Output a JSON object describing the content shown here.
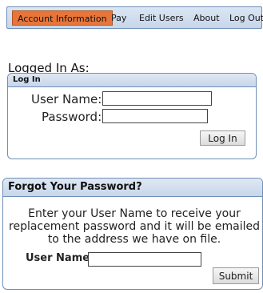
{
  "nav": {
    "items": [
      {
        "label": "Account Information",
        "active": true
      },
      {
        "label": "Pay",
        "active": false
      },
      {
        "label": "Edit Users",
        "active": false
      },
      {
        "label": "About",
        "active": false
      },
      {
        "label": "Log Out",
        "active": false
      }
    ]
  },
  "logged_in_as": "Logged In As:",
  "login": {
    "header": "Log In",
    "username_label": "User Name:",
    "username_value": "",
    "password_label": "Password:",
    "password_value": "",
    "button": "Log In"
  },
  "forgot": {
    "header": "Forgot Your Password?",
    "text": "Enter your User Name to receive your replacement password and it will be emailed to the address we have on file.",
    "username_label": "User Name:",
    "username_value": "",
    "button": "Submit"
  },
  "colors": {
    "accent": "#e8763a",
    "border": "#6f8fb8",
    "panel_header": "#c7d6ea"
  }
}
